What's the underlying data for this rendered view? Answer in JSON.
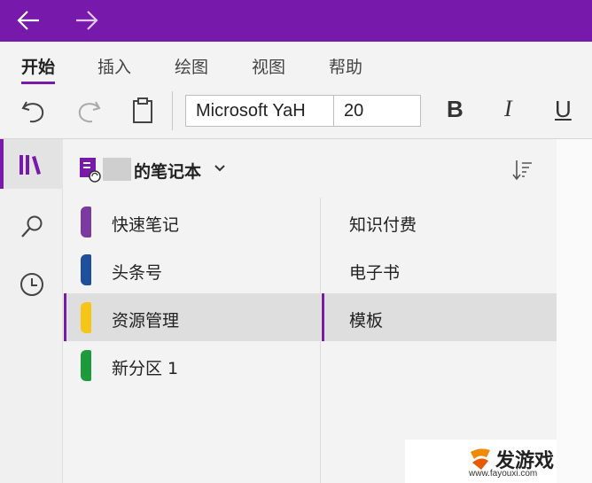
{
  "titlebar": {
    "back_icon": "arrow-left-icon",
    "forward_icon": "arrow-right-icon",
    "color": "#7719aa"
  },
  "ribbon_tabs": [
    {
      "label": "开始",
      "active": true
    },
    {
      "label": "插入"
    },
    {
      "label": "绘图"
    },
    {
      "label": "视图"
    },
    {
      "label": "帮助"
    }
  ],
  "toolbar": {
    "undo_icon": "undo-icon",
    "redo_icon": "redo-icon",
    "paste_icon": "clipboard-icon",
    "font_name": "Microsoft YaH",
    "font_size": "20",
    "bold": "B",
    "italic": "I",
    "underline": "U"
  },
  "leftnav": {
    "items": [
      "notebooks-icon",
      "search-icon",
      "recent-clock-icon"
    ]
  },
  "notebook": {
    "name": "的笔记本",
    "sort_icon": "sort-icon"
  },
  "sections": [
    {
      "label": "快速笔记",
      "color": "#7b3aa0"
    },
    {
      "label": "头条号",
      "color": "#1f4e9c"
    },
    {
      "label": "资源管理",
      "color": "#f5c518",
      "selected": true
    },
    {
      "label": "新分区 1",
      "color": "#1e9a3c"
    }
  ],
  "pages": [
    {
      "label": "知识付费"
    },
    {
      "label": "电子书"
    },
    {
      "label": "模板",
      "selected": true
    }
  ],
  "watermark": {
    "main": "发游戏",
    "url": "www.fayouxi.com"
  },
  "accent": "#7719aa"
}
